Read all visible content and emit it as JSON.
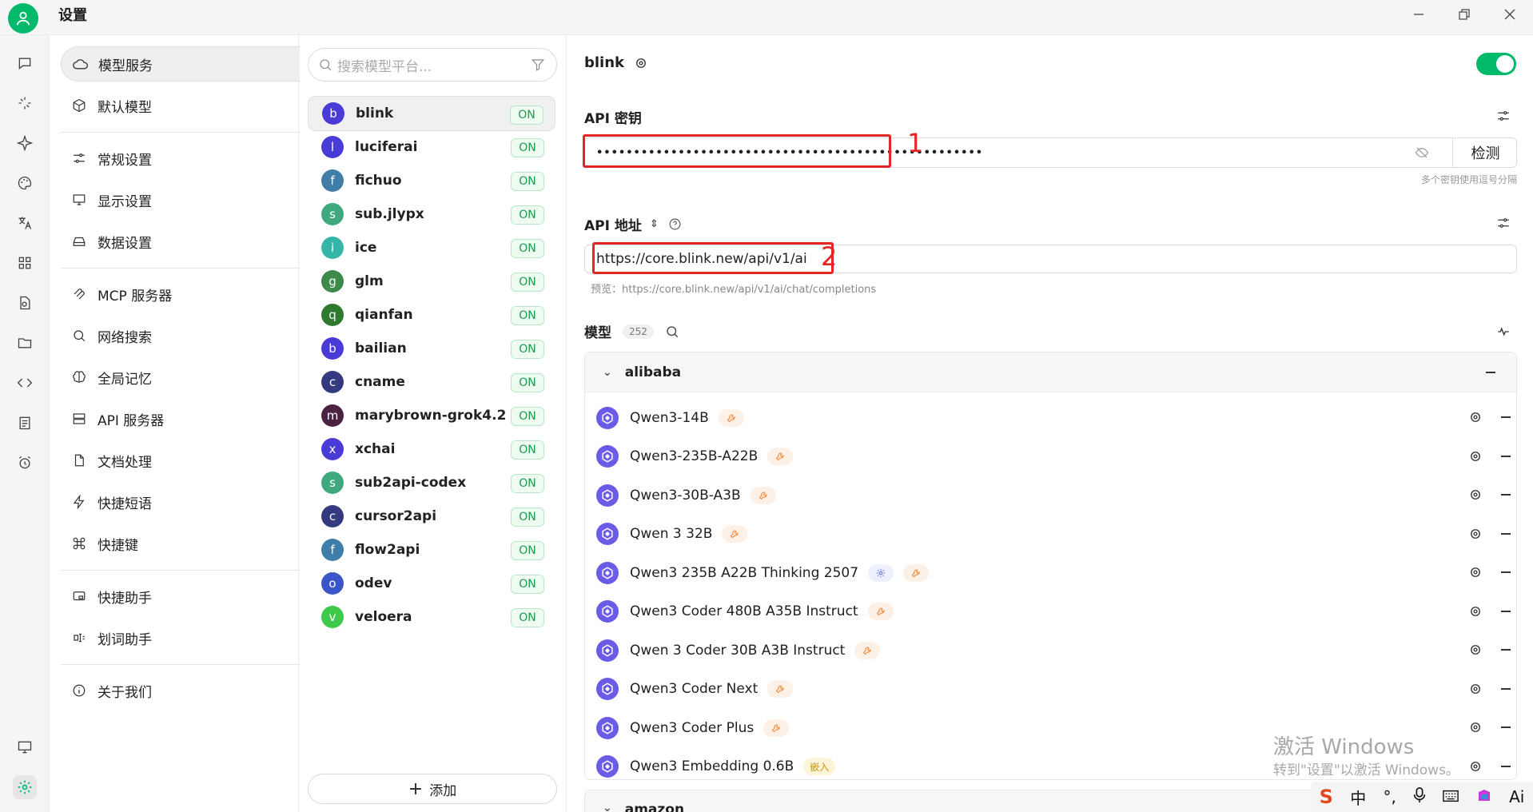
{
  "window": {
    "title": "设置"
  },
  "settings_nav": {
    "items": [
      {
        "label": "模型服务",
        "icon": "cloud-icon"
      },
      {
        "label": "默认模型",
        "icon": "cube-icon"
      },
      {
        "label": "常规设置",
        "icon": "sliders-icon"
      },
      {
        "label": "显示设置",
        "icon": "monitor-icon"
      },
      {
        "label": "数据设置",
        "icon": "drive-icon"
      },
      {
        "label": "MCP 服务器",
        "icon": "mcp-icon"
      },
      {
        "label": "网络搜索",
        "icon": "search-icon"
      },
      {
        "label": "全局记忆",
        "icon": "brain-icon"
      },
      {
        "label": "API 服务器",
        "icon": "server-icon"
      },
      {
        "label": "文档处理",
        "icon": "document-icon"
      },
      {
        "label": "快捷短语",
        "icon": "zap-icon"
      },
      {
        "label": "快捷键",
        "icon": "command-icon"
      },
      {
        "label": "快捷助手",
        "icon": "assistant-icon"
      },
      {
        "label": "划词助手",
        "icon": "text-select-icon"
      },
      {
        "label": "关于我们",
        "icon": "info-icon"
      }
    ]
  },
  "providers": {
    "search_placeholder": "搜索模型平台...",
    "on_label": "ON",
    "add_label": "添加",
    "items": [
      {
        "name": "blink",
        "letter": "b",
        "color": "#4a3ad6"
      },
      {
        "name": "luciferai",
        "letter": "l",
        "color": "#4a3ad6"
      },
      {
        "name": "fichuo",
        "letter": "f",
        "color": "#3f7ea8"
      },
      {
        "name": "sub.jlypx",
        "letter": "s",
        "color": "#3fa87c"
      },
      {
        "name": "ice",
        "letter": "i",
        "color": "#35b5a8"
      },
      {
        "name": "glm",
        "letter": "g",
        "color": "#3e8a4a"
      },
      {
        "name": "qianfan",
        "letter": "q",
        "color": "#2f7a2f"
      },
      {
        "name": "bailian",
        "letter": "b",
        "color": "#4a3ad6"
      },
      {
        "name": "cname",
        "letter": "c",
        "color": "#353a80"
      },
      {
        "name": "marybrown-grok4.2",
        "letter": "m",
        "color": "#4a2344"
      },
      {
        "name": "xchai",
        "letter": "x",
        "color": "#4a3ad6"
      },
      {
        "name": "sub2api-codex",
        "letter": "s",
        "color": "#3fa87c"
      },
      {
        "name": "cursor2api",
        "letter": "c",
        "color": "#353a80"
      },
      {
        "name": "flow2api",
        "letter": "f",
        "color": "#3f7ea8"
      },
      {
        "name": "odev",
        "letter": "o",
        "color": "#3a55c8"
      },
      {
        "name": "veloera",
        "letter": "v",
        "color": "#3ec94a"
      }
    ]
  },
  "detail": {
    "provider_name": "blink",
    "api_key_label": "API 密钥",
    "api_key_value": "••••••••••••••••••••••••••••••••••••••••••••••••••••",
    "check_label": "检测",
    "key_hint": "多个密钥使用逗号分隔",
    "api_url_label": "API 地址",
    "api_url_value": "https://core.blink.new/api/v1/ai",
    "preview_text": "预览：https://core.blink.new/api/v1/ai/chat/completions",
    "models_label": "模型",
    "models_count": "252",
    "annotation_1": "1",
    "annotation_2": "2",
    "groups": [
      {
        "name": "alibaba",
        "models": [
          {
            "name": "Qwen3-14B",
            "tags": [
              "tool"
            ]
          },
          {
            "name": "Qwen3-235B-A22B",
            "tags": [
              "tool"
            ]
          },
          {
            "name": "Qwen3-30B-A3B",
            "tags": [
              "tool"
            ]
          },
          {
            "name": "Qwen 3 32B",
            "tags": [
              "tool"
            ]
          },
          {
            "name": "Qwen3 235B A22B Thinking 2507",
            "tags": [
              "reasoning",
              "tool"
            ]
          },
          {
            "name": "Qwen3 Coder 480B A35B Instruct",
            "tags": [
              "tool"
            ]
          },
          {
            "name": "Qwen 3 Coder 30B A3B Instruct",
            "tags": [
              "tool"
            ]
          },
          {
            "name": "Qwen3 Coder Next",
            "tags": [
              "tool"
            ]
          },
          {
            "name": "Qwen3 Coder Plus",
            "tags": [
              "tool"
            ]
          },
          {
            "name": "Qwen3 Embedding 0.6B",
            "tags": [
              "embed"
            ]
          }
        ]
      },
      {
        "name": "amazon",
        "models": []
      }
    ],
    "embed_tag_label": "嵌入"
  },
  "watermark": {
    "line1": "激活 Windows",
    "line2": "转到\"设置\"以激活 Windows。"
  },
  "ime": {
    "lang": "中",
    "ai_label": "Ai"
  },
  "colors": {
    "accent": "#00b96b",
    "annotation": "#e52424",
    "model_icon": "#6b5ce7"
  }
}
